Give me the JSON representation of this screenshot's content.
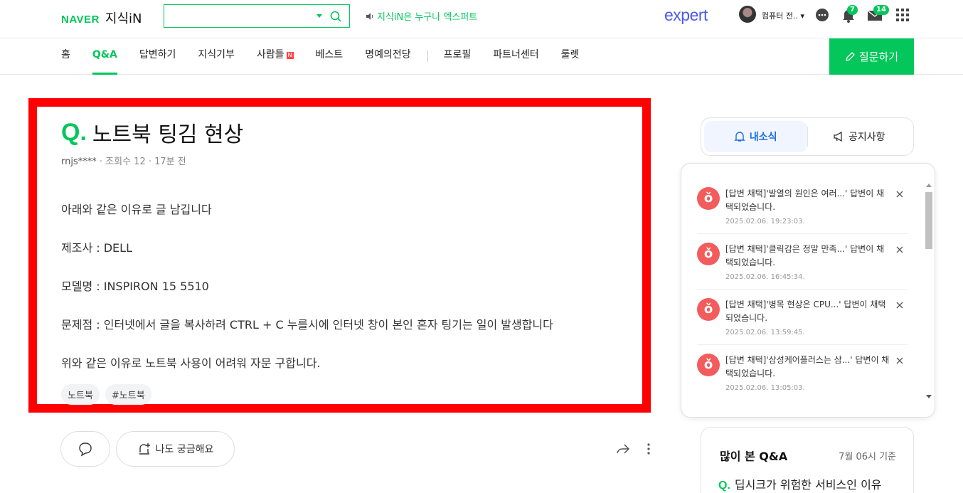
{
  "header": {
    "brand": "NAVER",
    "service": "지식iN",
    "search_placeholder": "",
    "promo": "지식iN은 누구나 엑스퍼트",
    "expert_logo": "expert",
    "user_name": "컴퓨터 전..",
    "badges": {
      "notifications": "7",
      "messages": "14"
    }
  },
  "nav": {
    "items": [
      "홈",
      "Q&A",
      "답변하기",
      "지식기부",
      "사람들",
      "베스트",
      "명예의전당",
      "프로필",
      "파트너센터",
      "룰렛"
    ],
    "active": "Q&A",
    "new_mark": "N",
    "ask_button": "질문하기"
  },
  "question": {
    "q_mark": "Q.",
    "title": "노트북 팅김 현상",
    "author": "rnjs****",
    "views": "조회수 12",
    "time": "17분 전",
    "body": [
      "아래와 같은 이유로 글 남깁니다",
      "제조사 : DELL",
      "모델명 : INSPIRON 15 5510",
      "문제점 : 인터넷에서 글을 복사하려 CTRL + C 누를시에 인터넷 창이 본인 혼자 팅기는 일이 발생합니다",
      "위와 같은 이유로 노트북 사용이 어려워 자문 구합니다."
    ],
    "tags": [
      "노트북",
      "#노트북"
    ],
    "curious_button": "나도 궁금해요"
  },
  "sidebar": {
    "tab_news": "내소식",
    "tab_notice": "공지사항",
    "notifications": [
      {
        "text": "[답변 채택]'발열의 원인은 여러...' 답변이 채택되었습니다.",
        "date": "2025.02.06. 19:23:03."
      },
      {
        "text": "[답변 채택]'클릭감은 정말 만족...' 답변이 채택되었습니다.",
        "date": "2025.02.06. 16:45:34."
      },
      {
        "text": "[답변 채택]'병목 현상은 CPU...' 답변이 채택되었습니다.",
        "date": "2025.02.06. 13:59:45."
      },
      {
        "text": "[답변 채택]'삼성케어플러스는 삼...' 답변이 채택되었습니다.",
        "date": "2025.02.06. 13:05:03."
      }
    ],
    "popular": {
      "title": "많이 본 Q&A",
      "date": "7월 06시 기준",
      "q_mark": "Q.",
      "first_item": "딥시크가 위험한 서비스인 이유"
    }
  },
  "colors": {
    "brand_green": "#03c75a",
    "highlight_red": "#ff0000",
    "notice_red": "#f25c5c",
    "tab_blue": "#1a6dde"
  },
  "icons": [
    "search-icon",
    "speaker-icon",
    "chat-icon",
    "bell-icon",
    "mail-icon",
    "apps-grid-icon",
    "pencil-icon",
    "comment-icon",
    "add-bell-icon",
    "share-icon",
    "more-icon",
    "close-icon"
  ]
}
